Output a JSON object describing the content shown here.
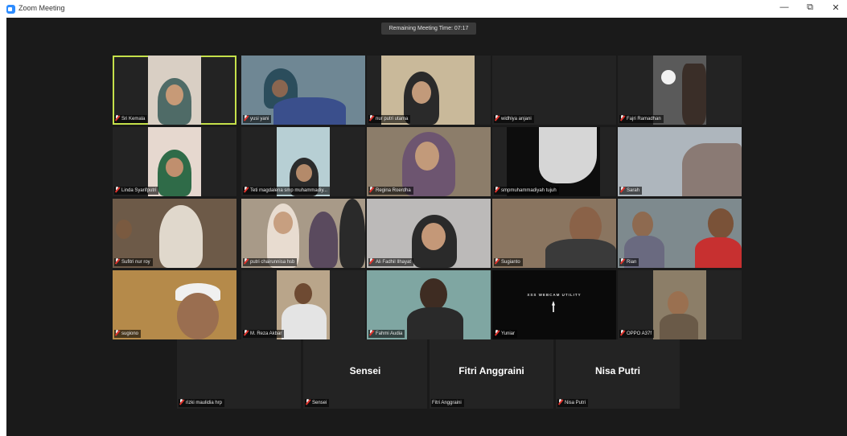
{
  "window": {
    "title": "Zoom Meeting",
    "minimize": "—",
    "restore": "⧉",
    "close": "✕"
  },
  "meeting": {
    "remaining_time": "Remaining Meeting Time: 07:17"
  },
  "colors": {
    "active_speaker_border": "#c5e04a",
    "muted_icon": "#e0322b",
    "background": "#1a1a1a"
  },
  "participants": [
    {
      "name": "Sri Kemala",
      "muted": true,
      "active": true
    },
    {
      "name": "yusi yani",
      "muted": true
    },
    {
      "name": "nur putri utama",
      "muted": true
    },
    {
      "name": "widhiya anjani",
      "muted": true
    },
    {
      "name": "Fajri Ramadhan",
      "muted": true
    },
    {
      "name": "Linda Syarifputri",
      "muted": true
    },
    {
      "name": "Teti magdalena smp muhammadiy...",
      "muted": true
    },
    {
      "name": "Regina Roerdha",
      "muted": true
    },
    {
      "name": "smpmuhammadiyah tujuh",
      "muted": true
    },
    {
      "name": "Sarah",
      "muted": true
    },
    {
      "name": "Sufitri nur roy",
      "muted": true
    },
    {
      "name": "putri chairunnisa hsb",
      "muted": true
    },
    {
      "name": "Ali Fadhil Ilhayat",
      "muted": true
    },
    {
      "name": "Sugianto",
      "muted": true
    },
    {
      "name": "Rian",
      "muted": true
    },
    {
      "name": "sugiono",
      "muted": true
    },
    {
      "name": "M. Reza Akbar",
      "muted": true
    },
    {
      "name": "Fahmi Audia",
      "muted": true
    },
    {
      "name": "Yuniar",
      "muted": true,
      "webcam_text": "XSS WEBCAM UTILITY"
    },
    {
      "name": "OPPO A37f",
      "muted": true
    },
    {
      "name": "rizki maulidia hrp",
      "muted": true
    },
    {
      "name": "Sensei",
      "muted": true,
      "display_name": "Sensei"
    },
    {
      "name": "Fitri Anggraini",
      "muted": false,
      "display_name": "Fitri Anggraini"
    },
    {
      "name": "Nisa Putri",
      "muted": true,
      "display_name": "Nisa Putri"
    }
  ]
}
